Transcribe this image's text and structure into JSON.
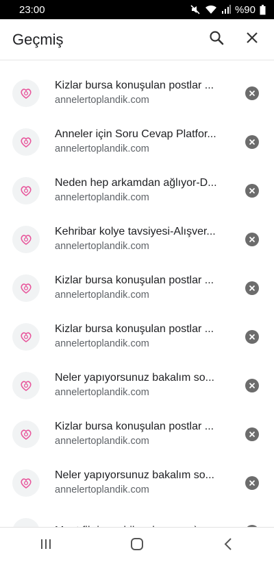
{
  "status_bar": {
    "time": "23:00",
    "battery_text": "%90",
    "icons": [
      "mute-icon",
      "wifi-icon",
      "signal-icon",
      "battery-icon"
    ]
  },
  "app_bar": {
    "title": "Geçmiş",
    "search_icon": "search-icon",
    "close_icon": "close-icon"
  },
  "history": {
    "items": [
      {
        "title": "Kizlar bursa konuşulan postlar ...",
        "url": "annelertoplandik.com"
      },
      {
        "title": "Anneler için Soru Cevap Platfor...",
        "url": "annelertoplandik.com"
      },
      {
        "title": "Neden hep arkamdan ağlıyor-D...",
        "url": "annelertoplandik.com"
      },
      {
        "title": "Kehribar kolye tavsiyesi-Alışver...",
        "url": "annelertoplandik.com"
      },
      {
        "title": "Kizlar bursa konuşulan postlar ...",
        "url": "annelertoplandik.com"
      },
      {
        "title": "Kizlar bursa konuşulan postlar ...",
        "url": "annelertoplandik.com"
      },
      {
        "title": "Neler yapıyorsunuz bakalım so...",
        "url": "annelertoplandik.com"
      },
      {
        "title": "Kizlar bursa konuşulan postlar ...",
        "url": "annelertoplandik.com"
      },
      {
        "title": "Neler yapıyorsunuz bakalım so...",
        "url": "annelertoplandik.com"
      },
      {
        "title": "Mont fikri verebilecek var mı:)-",
        "url": ""
      }
    ]
  },
  "colors": {
    "favicon_pink": "#e8559b",
    "favicon_bg": "#f1f3f4",
    "remove_bg": "#6c6c6c"
  },
  "nav_bar": {
    "icons": [
      "recent-apps-icon",
      "home-icon",
      "back-icon"
    ]
  }
}
